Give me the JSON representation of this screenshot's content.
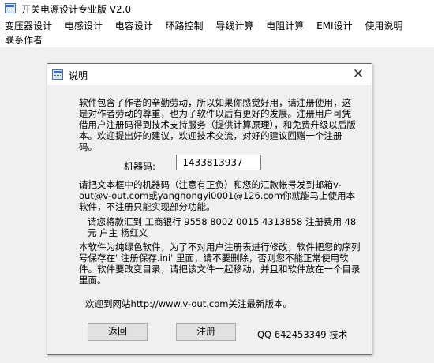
{
  "app": {
    "title": "开关电源设计专业版  V2.0",
    "icon": "app-window-icon"
  },
  "menu": {
    "items": [
      "变压器设计",
      "电感设计",
      "电容设计",
      "环路控制",
      "导线计算",
      "电阻计算",
      "EMI设计",
      "使用说明"
    ],
    "items_row2": [
      "联系作者"
    ]
  },
  "dialog": {
    "title": "说明",
    "icon": "app-window-icon",
    "close_glyph": "✕",
    "para1": "软件包含了作者的辛勤劳动，所以如果你感觉好用，请注册使用，这是对作者劳动的尊重，也为了软件以后有更好的发展。注册用户可凭借用户注册码得到技术支持服务（提供计算原理），和免费升级以后版本。欢迎提出好的建议，欢迎技术交流，对好的建议回赠一个注册码。",
    "machine_label": "机器码:",
    "machine_code": "-1433813937",
    "para2": "请把文本框中的机器码（注意有正负）和您的汇款帐号发到邮箱v-out@v-out.com或yanghongyi0001@126.com你就能马上使用本软件，不注册只能实现部分功能。",
    "para3": "请您将款汇到 工商银行 9558 8002 0015 4313858 注册费用 48元 户主 杨红义",
    "para4": "本软件为纯绿色软件，为了不对用户注册表进行修改，软件把您的序列号保存在' 注册保存.ini' 里面，请不要删除，否则您不能正常使用软件。软件要改变目录，请把该文件一起移动，并且和软件放在一个目录里面。",
    "para5": "欢迎到网站http://www.v-out.com关注最新版本。",
    "back_label": "返回",
    "register_label": "注册",
    "qq_text": "QQ 642453349 技术"
  }
}
